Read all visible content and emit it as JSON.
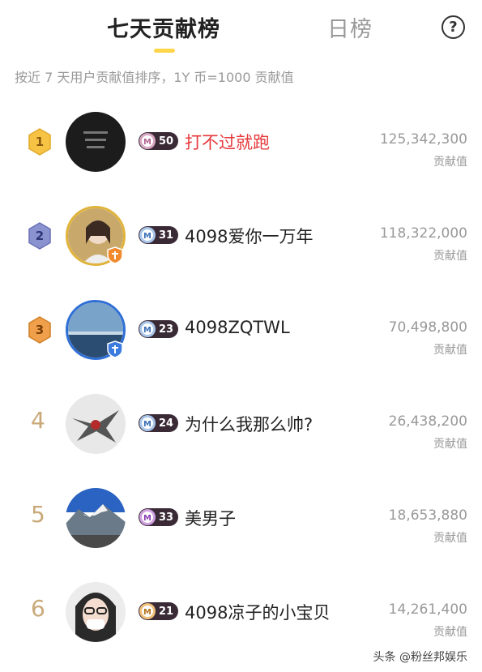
{
  "tabs": {
    "active": "七天贡献榜",
    "inactive": "日榜",
    "help": "?"
  },
  "subtitle": "按近 7 天用户贡献值排序，1Y 币=1000 贡献值",
  "value_label": "贡献值",
  "rows": [
    {
      "rank": "1",
      "level": "50",
      "name": "打不过就跑",
      "value": "125,342,300"
    },
    {
      "rank": "2",
      "level": "31",
      "name": "4098爱你一万年",
      "value": "118,322,000"
    },
    {
      "rank": "3",
      "level": "23",
      "name": "4098ZQTWL",
      "value": "70,498,800"
    },
    {
      "rank": "4",
      "level": "24",
      "name": "为什么我那么帅?",
      "value": "26,438,200"
    },
    {
      "rank": "5",
      "level": "33",
      "name": "美男子",
      "value": "18,653,880"
    },
    {
      "rank": "6",
      "level": "21",
      "name": "4098凉子的小宝贝",
      "value": "14,261,400"
    }
  ],
  "watermark": "头条 @粉丝邦娱乐",
  "colors": {
    "accent": "#ffd54a",
    "gold": "#f6c344",
    "silver": "#7f86c6",
    "bronze": "#f0a04a",
    "rank_plain": "#c9a979",
    "highlight_name": "#e5393c"
  },
  "icons": {
    "help": "help-circle-icon",
    "guard": "shield-guard-icon",
    "medal": "medal-m-icon"
  }
}
